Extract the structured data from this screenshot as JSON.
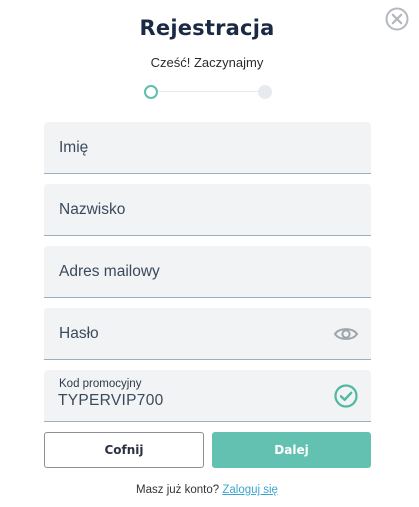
{
  "dialog": {
    "title": "Rejestracja",
    "subtitle": "Cześć! Zaczynajmy"
  },
  "stepper": {
    "current_step": 1,
    "total_steps": 2,
    "active_color": "#5ec0ac"
  },
  "form": {
    "first_name": {
      "placeholder": "Imię",
      "value": ""
    },
    "last_name": {
      "placeholder": "Nazwisko",
      "value": ""
    },
    "email": {
      "placeholder": "Adres mailowy",
      "value": ""
    },
    "password": {
      "placeholder": "Hasło",
      "value": "",
      "icon": "eye-icon"
    },
    "promo_code": {
      "label": "Kod promocyjny",
      "value": "TYPERVIP700",
      "status_icon": "check-circle-icon",
      "valid": true
    }
  },
  "buttons": {
    "back_label": "Cofnij",
    "next_label": "Dalej"
  },
  "footer": {
    "prompt": "Masz już konto?",
    "login_link": "Zaloguj się"
  },
  "colors": {
    "accent": "#62c1b0",
    "link": "#3aa6d0",
    "title": "#1b2a44"
  }
}
